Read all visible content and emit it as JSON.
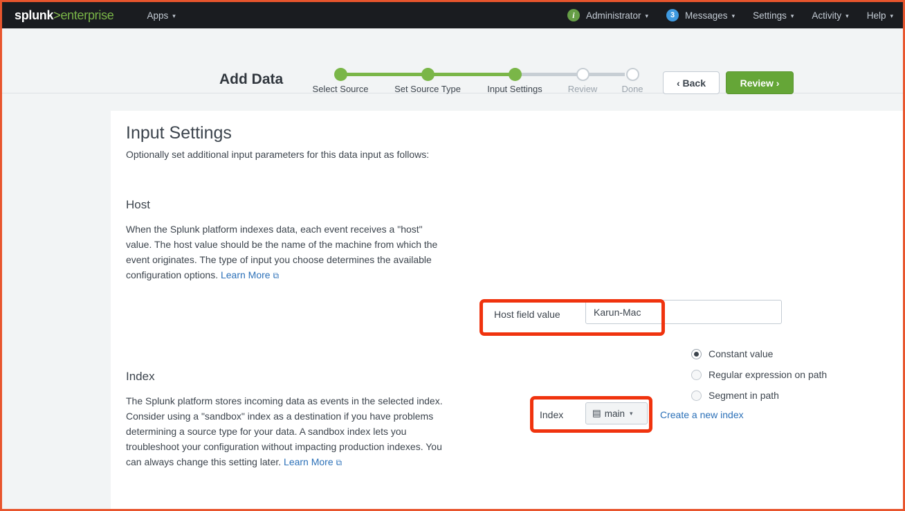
{
  "topnav": {
    "logo": {
      "splunk": "splunk",
      "gt": ">",
      "enterprise": "enterprise"
    },
    "apps": {
      "label": "Apps",
      "caret": "▾"
    },
    "right_items": [
      {
        "badge": "i",
        "label": "Administrator",
        "caret": "▾"
      },
      {
        "badge": "3",
        "label": "Messages",
        "caret": "▾"
      },
      {
        "badge": null,
        "label": "Settings",
        "caret": "▾"
      },
      {
        "badge": null,
        "label": "Activity",
        "caret": "▾"
      },
      {
        "badge": null,
        "label": "Help",
        "caret": "▾"
      }
    ]
  },
  "wizard": {
    "title": "Add Data",
    "steps": [
      {
        "label": "Select Source",
        "state": "done"
      },
      {
        "label": "Set Source Type",
        "state": "done"
      },
      {
        "label": "Input Settings",
        "state": "done"
      },
      {
        "label": "Review",
        "state": "todo"
      },
      {
        "label": "Done",
        "state": "todo"
      }
    ],
    "back_label": "‹ Back",
    "review_label": "Review ›",
    "accent_done": "#7ab648",
    "accent_todo": "#c7ced4"
  },
  "page": {
    "heading": "Input Settings",
    "subheading": "Optionally set additional input parameters for this data input as follows:"
  },
  "host": {
    "title": "Host",
    "body": "When the Splunk platform indexes data, each event receives a \"host\" value. The host value should be the name of the machine from which the event originates. The type of input you choose determines the available configuration options. ",
    "learn_more": "Learn More",
    "external_icon": "⧉",
    "options": [
      {
        "label": "Constant value",
        "selected": true
      },
      {
        "label": "Regular expression on path",
        "selected": false
      },
      {
        "label": "Segment in path",
        "selected": false
      }
    ],
    "field_label": "Host field value",
    "field_value": "Karun-Mac",
    "field_placeholder": ""
  },
  "index": {
    "title": "Index",
    "body": "The Splunk platform stores incoming data as events in the selected index. Consider using a \"sandbox\" index as a destination if you have problems determining a source type for your data. A sandbox index lets you troubleshoot your configuration without impacting production indexes. You can always change this setting later. ",
    "learn_more": "Learn More",
    "external_icon": "⧉",
    "field_label": "Index",
    "selected_value": "main",
    "dropdown_icon": "▤",
    "caret": "▾",
    "create_link": "Create a new index"
  },
  "annotations": {
    "color": "#f0330e"
  }
}
